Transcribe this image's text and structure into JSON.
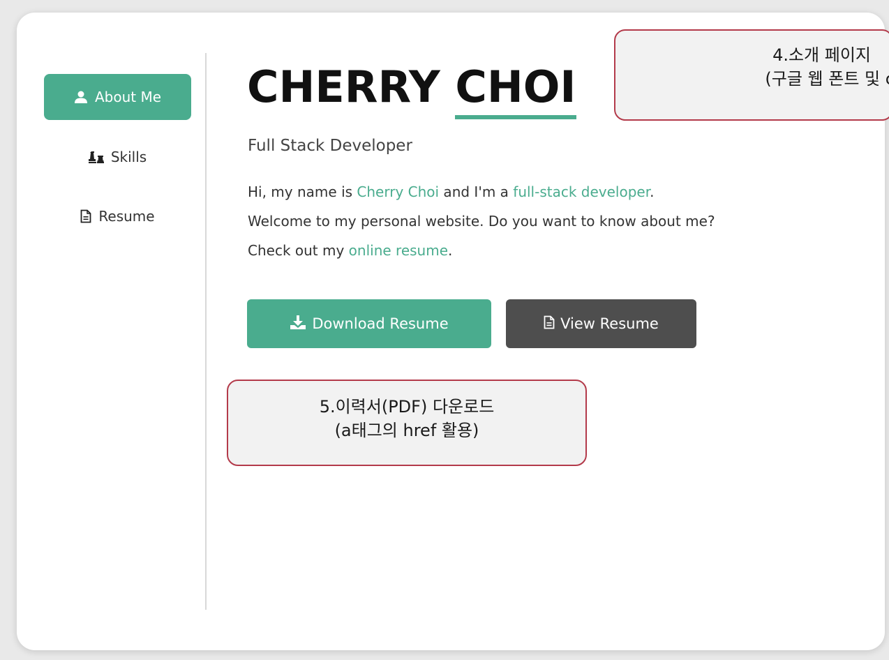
{
  "sidebar": {
    "items": [
      {
        "label": "About Me",
        "icon": "user-icon",
        "active": true
      },
      {
        "label": "Skills",
        "icon": "chess-icon",
        "active": false
      },
      {
        "label": "Resume",
        "icon": "document-icon",
        "active": false
      }
    ]
  },
  "main": {
    "name_first": "CHERRY",
    "name_last": "CHOI",
    "subtitle": "Full Stack Developer",
    "intro": {
      "line1_a": "Hi, my name is ",
      "line1_link1": "Cherry Choi",
      "line1_b": " and I'm a ",
      "line1_link2": "full-stack developer",
      "line1_c": ".",
      "line2": "Welcome to my personal website. Do you want to know about me?",
      "line3_a": "Check out my ",
      "line3_link": "online resume",
      "line3_b": "."
    },
    "buttons": {
      "download_label": "Download Resume",
      "view_label": "View Resume"
    }
  },
  "annotations": {
    "callout4_line1": "4.소개 페이지",
    "callout4_line2": "(구글 웹 폰트 및 colo",
    "callout5_line1": "5.이력서(PDF) 다운로드",
    "callout5_line2": "(a태그의 href 활용)"
  },
  "colors": {
    "accent": "#4aac8e",
    "dark_button": "#4e4e4e",
    "callout_border": "#b33a4a"
  }
}
